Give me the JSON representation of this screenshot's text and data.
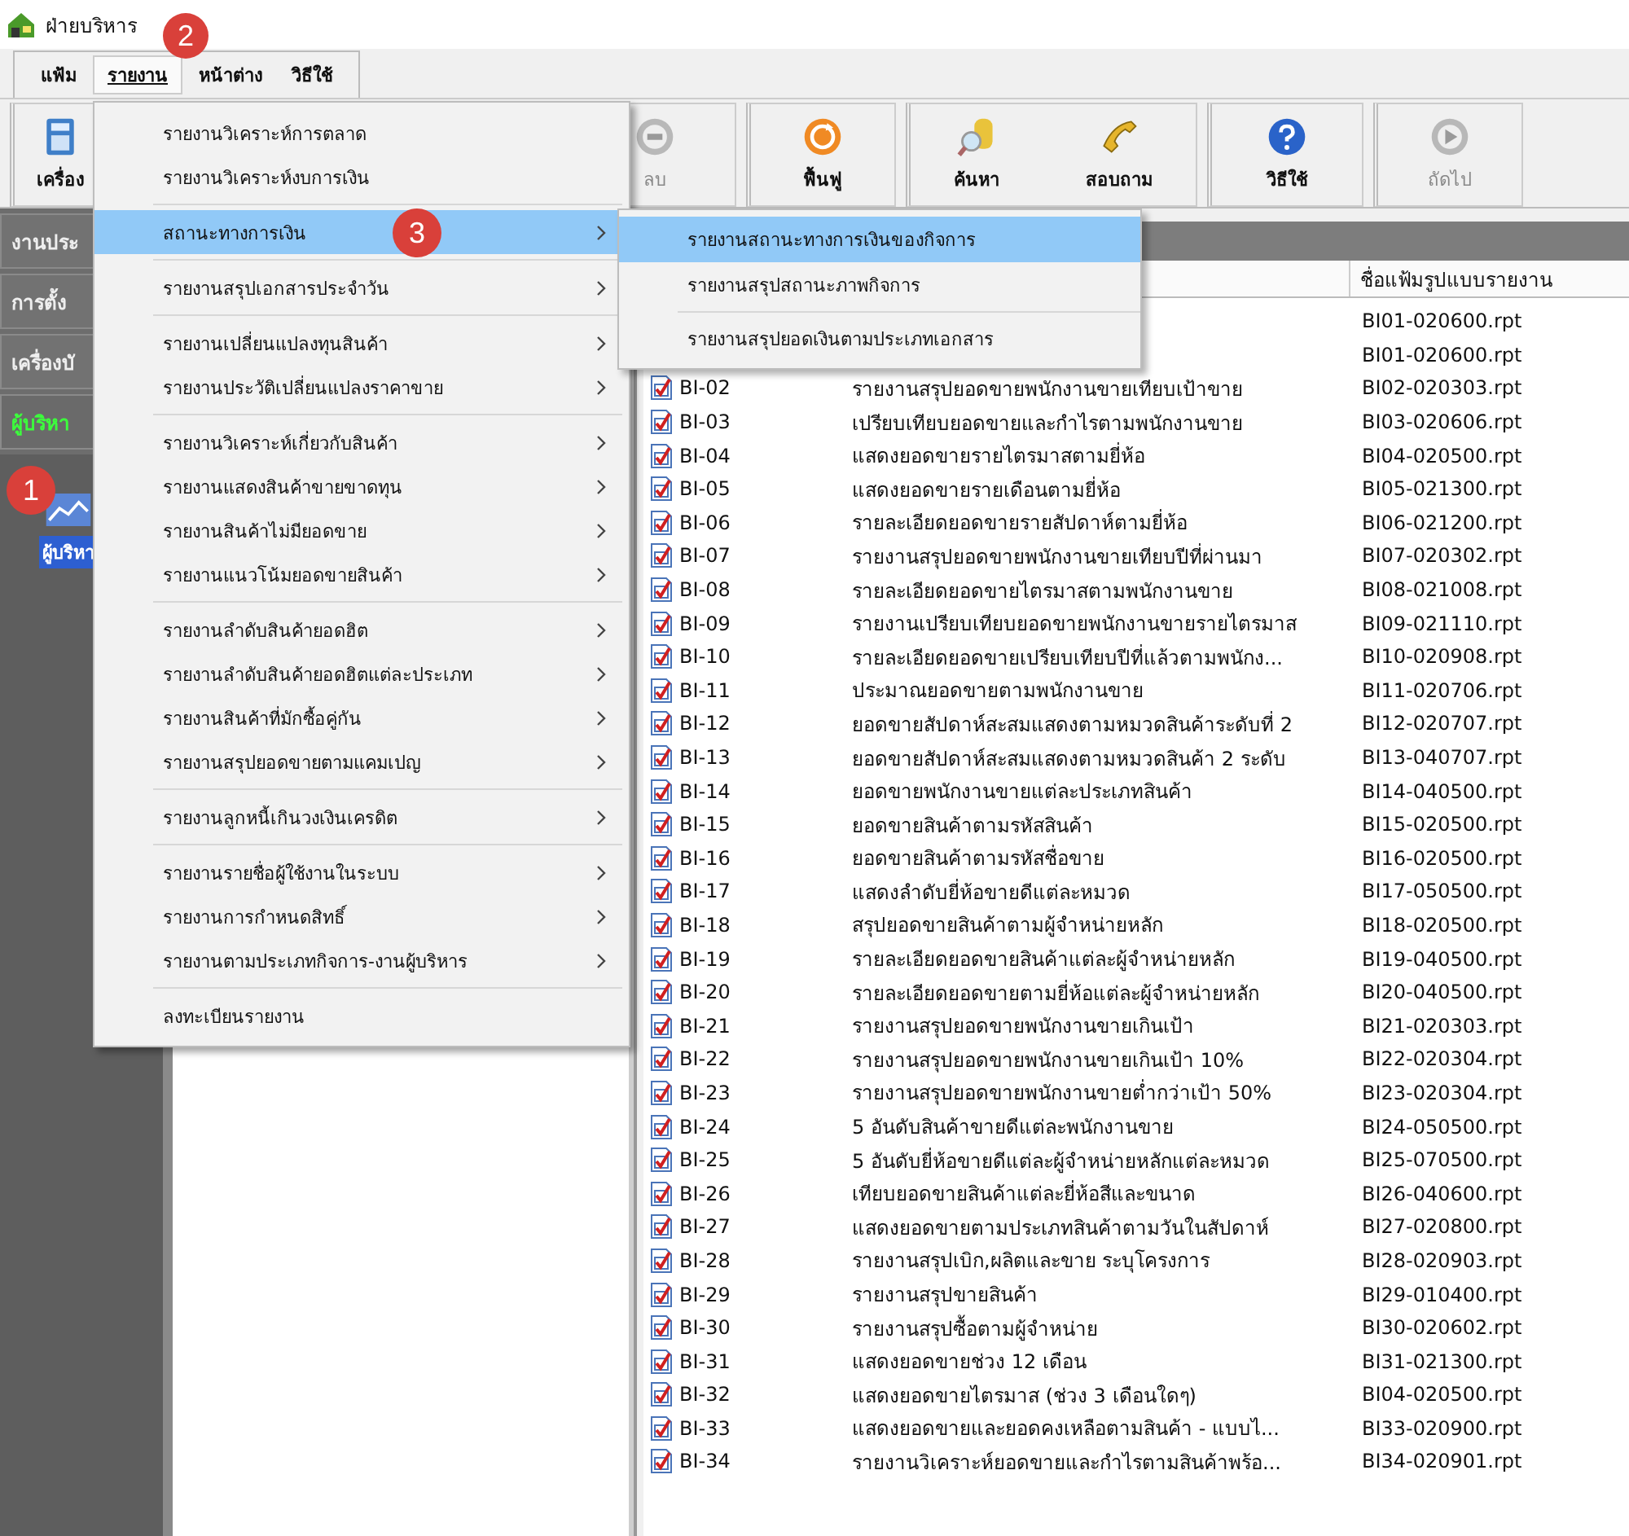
{
  "window": {
    "title": "ฝ่ายบริหาร"
  },
  "menu_bar": [
    {
      "label": "แฟ้ม",
      "selected": false
    },
    {
      "label": "รายงาน",
      "selected": true
    },
    {
      "label": "หน้าต่าง",
      "selected": false
    },
    {
      "label": "วิธีใช้",
      "selected": false
    }
  ],
  "toolbar_groups": [
    [
      {
        "label": "เครื่อง",
        "kind": "calculator",
        "disabled": false
      }
    ],
    [
      {
        "label": "ลบ",
        "kind": "delete",
        "disabled": true
      }
    ],
    [
      {
        "label": "ฟื้นฟู",
        "kind": "refresh",
        "disabled": false
      }
    ],
    [
      {
        "label": "ค้นหา",
        "kind": "search",
        "disabled": false
      },
      {
        "label": "สอบถาม",
        "kind": "phone",
        "disabled": false
      }
    ],
    [
      {
        "label": "วิธีใช้",
        "kind": "help",
        "disabled": false
      }
    ],
    [
      {
        "label": "ถัดไป",
        "kind": "next",
        "disabled": true
      }
    ]
  ],
  "sidebar": {
    "buttons": [
      {
        "label": "งานประ",
        "selected": false
      },
      {
        "label": "การตั้ง",
        "selected": false
      },
      {
        "label": "เครื่องบั",
        "selected": false
      },
      {
        "label": "ผู้บริหา",
        "selected": true
      }
    ],
    "shortcuts": [
      {
        "label": "ผู้บริหา",
        "selected": true
      }
    ]
  },
  "report_menu": {
    "groups": [
      [
        {
          "label": "รายงานวิเคราะห์การตลาด",
          "submenu": false,
          "selected": false
        },
        {
          "label": "รายงานวิเคราะห์งบการเงิน",
          "submenu": false,
          "selected": false
        }
      ],
      [
        {
          "label": "สถานะทางการเงิน",
          "submenu": true,
          "selected": true
        }
      ],
      [
        {
          "label": "รายงานสรุปเอกสารประจำวัน",
          "submenu": true,
          "selected": false
        }
      ],
      [
        {
          "label": "รายงานเปลี่ยนแปลงทุนสินค้า",
          "submenu": true,
          "selected": false
        },
        {
          "label": "รายงานประวัติเปลี่ยนแปลงราคาขาย",
          "submenu": true,
          "selected": false
        }
      ],
      [
        {
          "label": "รายงานวิเคราะห์เกี่ยวกับสินค้า",
          "submenu": true,
          "selected": false
        },
        {
          "label": "รายงานแสดงสินค้าขายขาดทุน",
          "submenu": true,
          "selected": false
        },
        {
          "label": "รายงานสินค้าไม่มียอดขาย",
          "submenu": true,
          "selected": false
        },
        {
          "label": "รายงานแนวโน้มยอดขายสินค้า",
          "submenu": true,
          "selected": false
        }
      ],
      [
        {
          "label": "รายงานลำดับสินค้ายอดฮิต",
          "submenu": true,
          "selected": false
        },
        {
          "label": "รายงานลำดับสินค้ายอดฮิตแต่ละประเภท",
          "submenu": true,
          "selected": false
        },
        {
          "label": "รายงานสินค้าที่มักซื้อคู่กัน",
          "submenu": true,
          "selected": false
        },
        {
          "label": "รายงานสรุปยอดขายตามแคมเปญ",
          "submenu": true,
          "selected": false
        }
      ],
      [
        {
          "label": "รายงานลูกหนี้เกินวงเงินเครดิต",
          "submenu": true,
          "selected": false
        }
      ],
      [
        {
          "label": "รายงานรายชื่อผู้ใช้งานในระบบ",
          "submenu": true,
          "selected": false
        },
        {
          "label": "รายงานการกำหนดสิทธิ์",
          "submenu": true,
          "selected": false
        },
        {
          "label": "รายงานตามประเภทกิจการ-งานผู้บริหาร",
          "submenu": true,
          "selected": false
        }
      ],
      [
        {
          "label": "ลงทะเบียนรายงาน",
          "submenu": false,
          "selected": false
        }
      ]
    ]
  },
  "submenu": {
    "groups": [
      [
        {
          "label": "รายงานสถานะทางการเงินของกิจการ",
          "selected": true
        },
        {
          "label": "รายงานสรุปสถานะภาพกิจการ",
          "selected": false
        }
      ],
      [
        {
          "label": "รายงานสรุปยอดเงินตามประเภทเอกสาร",
          "selected": false
        }
      ]
    ]
  },
  "table": {
    "file_column_header": "ชื่อแฟ้มรูปแบบรายงาน",
    "rows": [
      {
        "file": "BI01-020600.rpt"
      },
      {
        "file": "BI01-020600.rpt"
      },
      {
        "id": "BI-02",
        "name": "รายงานสรุปยอดขายพนักงานขายเทียบเป้าขาย",
        "file": "BI02-020303.rpt",
        "checked": true
      },
      {
        "id": "BI-03",
        "name": "เปรียบเทียบยอดขายและกำไรตามพนักงานขาย",
        "file": "BI03-020606.rpt",
        "checked": true
      },
      {
        "id": "BI-04",
        "name": "แสดงยอดขายรายไตรมาสตามยี่ห้อ",
        "file": "BI04-020500.rpt",
        "checked": true
      },
      {
        "id": "BI-05",
        "name": "แสดงยอดขายรายเดือนตามยี่ห้อ",
        "file": "BI05-021300.rpt",
        "checked": true
      },
      {
        "id": "BI-06",
        "name": "รายละเอียดยอดขายรายสัปดาห์ตามยี่ห้อ",
        "file": "BI06-021200.rpt",
        "checked": true
      },
      {
        "id": "BI-07",
        "name": "รายงานสรุปยอดขายพนักงานขายเทียบปีที่ผ่านมา",
        "file": "BI07-020302.rpt",
        "checked": true
      },
      {
        "id": "BI-08",
        "name": "รายละเอียดยอดขายไตรมาสตามพนักงานขาย",
        "file": "BI08-021008.rpt",
        "checked": true
      },
      {
        "id": "BI-09",
        "name": "รายงานเปรียบเทียบยอดขายพนักงานขายรายไตรมาส",
        "file": "BI09-021110.rpt",
        "checked": true
      },
      {
        "id": "BI-10",
        "name": "รายละเอียดยอดขายเปรียบเทียบปีที่แล้วตามพนักง...",
        "file": "BI10-020908.rpt",
        "checked": true
      },
      {
        "id": "BI-11",
        "name": "ประมาณยอดขายตามพนักงานขาย",
        "file": "BI11-020706.rpt",
        "checked": true
      },
      {
        "id": "BI-12",
        "name": "ยอดขายสัปดาห์สะสมแสดงตามหมวดสินค้าระดับที่ 2",
        "file": "BI12-020707.rpt",
        "checked": true
      },
      {
        "id": "BI-13",
        "name": "ยอดขายสัปดาห์สะสมแสดงตามหมวดสินค้า 2 ระดับ",
        "file": "BI13-040707.rpt",
        "checked": true
      },
      {
        "id": "BI-14",
        "name": "ยอดขายพนักงานขายแต่ละประเภทสินค้า",
        "file": "BI14-040500.rpt",
        "checked": true
      },
      {
        "id": "BI-15",
        "name": "ยอดขายสินค้าตามรหัสสินค้า",
        "file": "BI15-020500.rpt",
        "checked": true
      },
      {
        "id": "BI-16",
        "name": "ยอดขายสินค้าตามรหัสชื่อขาย",
        "file": "BI16-020500.rpt",
        "checked": true
      },
      {
        "id": "BI-17",
        "name": "แสดงลำดับยี่ห้อขายดีแต่ละหมวด",
        "file": "BI17-050500.rpt",
        "checked": true
      },
      {
        "id": "BI-18",
        "name": "สรุปยอดขายสินค้าตามผู้จำหน่ายหลัก",
        "file": "BI18-020500.rpt",
        "checked": true
      },
      {
        "id": "BI-19",
        "name": "รายละเอียดยอดขายสินค้าแต่ละผู้จำหน่ายหลัก",
        "file": "BI19-040500.rpt",
        "checked": true
      },
      {
        "id": "BI-20",
        "name": "รายละเอียดยอดขายตามยี่ห้อแต่ละผู้จำหน่ายหลัก",
        "file": "BI20-040500.rpt",
        "checked": true
      },
      {
        "id": "BI-21",
        "name": "รายงานสรุปยอดขายพนักงานขายเกินเป้า",
        "file": "BI21-020303.rpt",
        "checked": true
      },
      {
        "id": "BI-22",
        "name": "รายงานสรุปยอดขายพนักงานขายเกินเป้า 10%",
        "file": "BI22-020304.rpt",
        "checked": true
      },
      {
        "id": "BI-23",
        "name": "รายงานสรุปยอดขายพนักงานขายต่ำกว่าเป้า 50%",
        "file": "BI23-020304.rpt",
        "checked": true
      },
      {
        "id": "BI-24",
        "name": "5 อันดับสินค้าขายดีแต่ละพนักงานขาย",
        "file": "BI24-050500.rpt",
        "checked": true
      },
      {
        "id": "BI-25",
        "name": "5 อันดับยี่ห้อขายดีแต่ละผู้จำหน่ายหลักแต่ละหมวด",
        "file": "BI25-070500.rpt",
        "checked": true
      },
      {
        "id": "BI-26",
        "name": "เทียบยอดขายสินค้าแต่ละยี่ห้อสีและขนาด",
        "file": "BI26-040600.rpt",
        "checked": true
      },
      {
        "id": "BI-27",
        "name": "แสดงยอดขายตามประเภทสินค้าตามวันในสัปดาห์",
        "file": "BI27-020800.rpt",
        "checked": true
      },
      {
        "id": "BI-28",
        "name": "รายงานสรุปเบิก,ผลิตและขาย ระบุโครงการ",
        "file": "BI28-020903.rpt",
        "checked": true
      },
      {
        "id": "BI-29",
        "name": "รายงานสรุปขายสินค้า",
        "file": "BI29-010400.rpt",
        "checked": true
      },
      {
        "id": "BI-30",
        "name": "รายงานสรุปซื้อตามผู้จำหน่าย",
        "file": "BI30-020602.rpt",
        "checked": true
      },
      {
        "id": "BI-31",
        "name": "แสดงยอดขายช่วง 12 เดือน",
        "file": "BI31-021300.rpt",
        "checked": true
      },
      {
        "id": "BI-32",
        "name": "แสดงยอดขายไตรมาส  (ช่วง 3 เดือนใดๆ)",
        "file": "BI04-020500.rpt",
        "checked": true
      },
      {
        "id": "BI-33",
        "name": "แสดงยอดขายและยอดคงเหลือตามสินค้า - แบบไ...",
        "file": "BI33-020900.rpt",
        "checked": true
      },
      {
        "id": "BI-34",
        "name": "รายงานวิเคราะห์ยอดขายและกำไรตามสินค้าพร้อ...",
        "file": "BI34-020901.rpt",
        "checked": true
      }
    ]
  },
  "callouts": [
    {
      "label": "1"
    },
    {
      "label": "2"
    },
    {
      "label": "3"
    }
  ]
}
